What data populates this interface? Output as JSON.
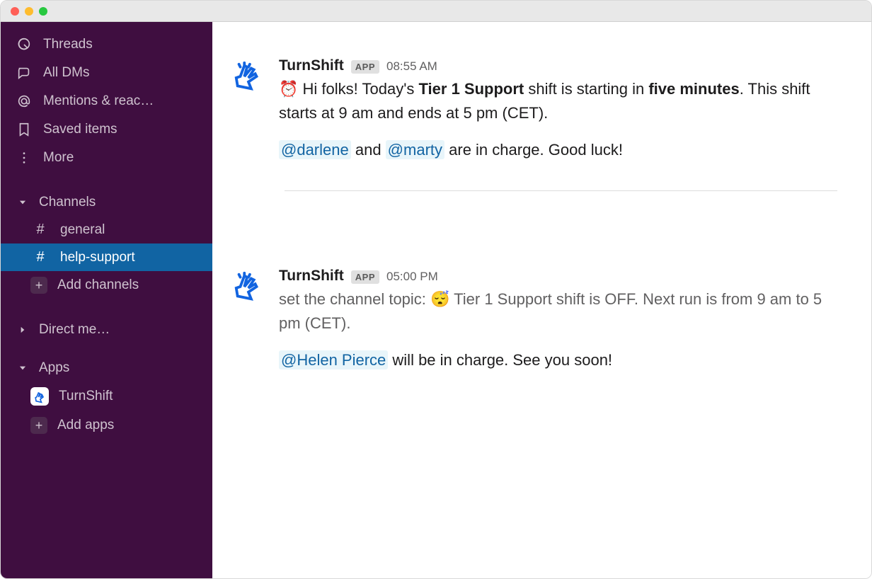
{
  "sidebar": {
    "nav": [
      {
        "id": "threads",
        "label": "Threads",
        "icon": "threads-icon"
      },
      {
        "id": "all-dms",
        "label": "All DMs",
        "icon": "dms-icon"
      },
      {
        "id": "mentions",
        "label": "Mentions & reac…",
        "icon": "at-icon"
      },
      {
        "id": "saved",
        "label": "Saved items",
        "icon": "bookmark-icon"
      },
      {
        "id": "more",
        "label": "More",
        "icon": "more-icon"
      }
    ],
    "channels_header": "Channels",
    "channels": [
      {
        "id": "general",
        "label": "general",
        "active": false
      },
      {
        "id": "help-support",
        "label": "help-support",
        "active": true
      }
    ],
    "add_channels_label": "Add channels",
    "dm_header": "Direct me…",
    "apps_header": "Apps",
    "apps": [
      {
        "id": "turnshift",
        "label": "TurnShift"
      }
    ],
    "add_apps_label": "Add apps"
  },
  "messages": [
    {
      "sender": "TurnShift",
      "badge": "APP",
      "time": "08:55 AM",
      "emoji": "⏰",
      "line1_pre": "Hi folks! Today's ",
      "line1_bold1": "Tier 1 Support",
      "line1_mid": " shift is starting in ",
      "line1_bold2": "five minutes",
      "line1_post": ". This shift starts at 9 am and ends at 5 pm (CET).",
      "line2_m1": "@darlene",
      "line2_sep": " and ",
      "line2_m2": "@marty",
      "line2_post": " are in charge. Good luck!"
    },
    {
      "sender": "TurnShift",
      "badge": "APP",
      "time": "05:00 PM",
      "topic_pre": "set the channel topic: ",
      "emoji": "😴",
      "topic_post": " Tier 1 Support shift is OFF. Next run is from 9 am to 5 pm (CET).",
      "line2_m1": "@Helen Pierce",
      "line2_post": " will be in charge. See you soon!"
    }
  ]
}
